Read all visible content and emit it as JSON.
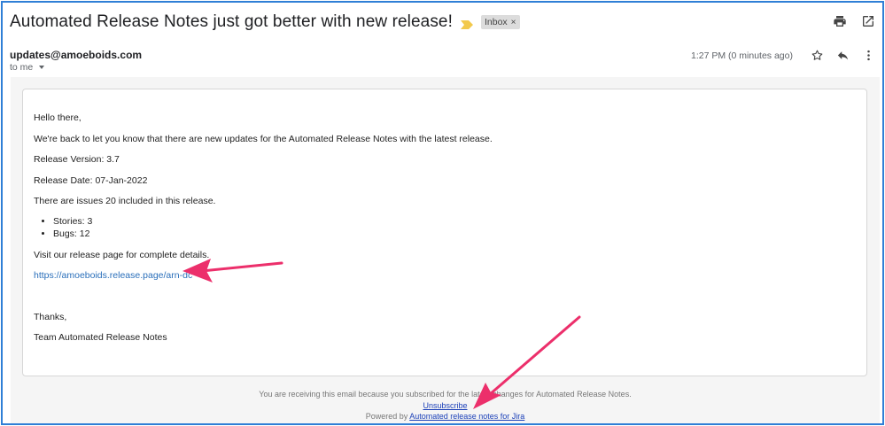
{
  "email": {
    "subject": "Automated Release Notes just got better with new release!",
    "label": "Inbox",
    "label_close": "×",
    "sender": "updates@amoeboids.com",
    "to": "to me",
    "time": "1:27 PM (0 minutes ago)"
  },
  "body": {
    "greeting": "Hello there,",
    "intro": "We're back to let you know that there are new updates for the Automated Release Notes with the latest release.",
    "version": "Release Version: 3.7",
    "date": "Release Date: 07-Jan-2022",
    "issues": "There are issues 20 included in this release.",
    "bullets": [
      "Stories: 3",
      "Bugs: 12"
    ],
    "visit": "Visit our release page for complete details.",
    "link": "https://amoeboids.release.page/arn-dc",
    "thanks": "Thanks,",
    "signature": "Team Automated Release Notes"
  },
  "footer": {
    "notice": "You are receiving this email because you subscribed for the latest changes for Automated Release Notes.",
    "unsubscribe": "Unsubscribe",
    "powered_prefix": "Powered by",
    "powered_link": "Automated release notes for Jira"
  },
  "colors": {
    "frame": "#2f7fd6",
    "annotation_arrow": "#ec2f6b",
    "link": "#2a6fba"
  },
  "icons": [
    "importance-marker-icon",
    "print-icon",
    "open-in-new-window-icon",
    "star-icon",
    "reply-icon",
    "more-vert-icon"
  ]
}
